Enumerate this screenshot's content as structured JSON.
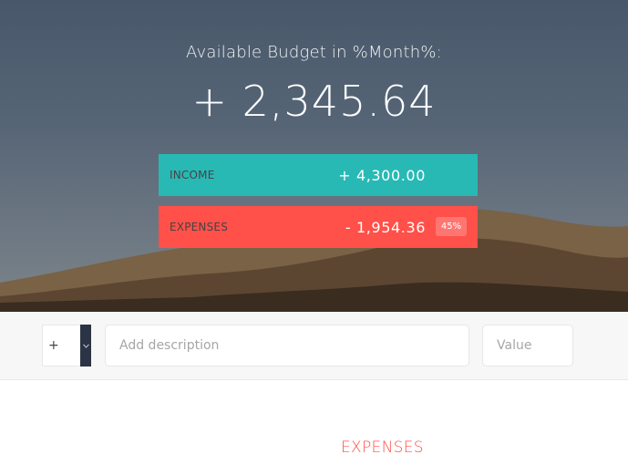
{
  "budget": {
    "title": "Available Budget in %Month%:",
    "value": "+ 2,345.64"
  },
  "income": {
    "label": "Income",
    "value": "+ 4,300.00"
  },
  "expenses": {
    "label": "Expenses",
    "value": "- 1,954.36",
    "percentage": "45%"
  },
  "add": {
    "type_value": "+",
    "type_arrow_icon": "chevron-down-icon",
    "description_placeholder": "Add description",
    "value_placeholder": "Value"
  },
  "lists": {
    "expenses_title": "EXPENSES"
  },
  "colors": {
    "income": "#28b9b5",
    "expenses": "#ff5049",
    "dark": "#2b3445"
  }
}
